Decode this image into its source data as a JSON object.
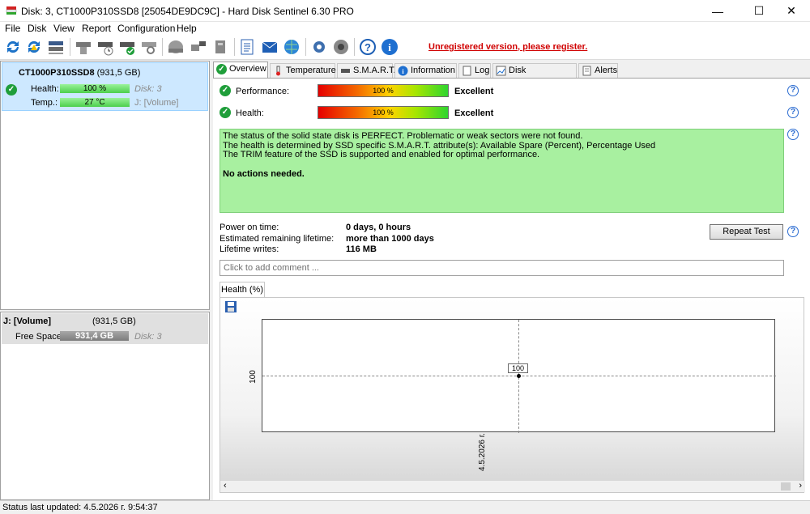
{
  "window": {
    "title": "Disk: 3, CT1000P310SSD8 [25054DE9DC9C]  -  Hard Disk Sentinel 6.30 PRO",
    "minimize": "—",
    "maximize": "☐",
    "close": "✕"
  },
  "menu": [
    "File",
    "Disk",
    "View",
    "Report",
    "Configuration",
    "Help"
  ],
  "toolbar": {
    "icons": [
      "refresh-icon",
      "refresh-warning-icon",
      "disk-list-icon",
      "disk-info-icon",
      "disk-schedule-icon",
      "disk-check-icon",
      "disk-search-icon",
      "disk-surface-icon",
      "disk-network-icon",
      "disk-backup-icon",
      "report-icon",
      "email-icon",
      "globe-icon",
      "settings-icon",
      "speaker-icon",
      "help-icon",
      "about-icon"
    ],
    "register_text": "Unregistered version, please register."
  },
  "disk": {
    "name": "CT1000P310SSD8",
    "size": "(931,5 GB)",
    "health_label": "Health:",
    "health_value": "100 %",
    "health_percent": 100,
    "temp_label": "Temp.:",
    "temp_value": "27 °C",
    "disk_no": "Disk: 3",
    "volume": "J: [Volume]"
  },
  "volume": {
    "name": "J: [Volume]",
    "size": "(931,5 GB)",
    "free_label": "Free Space",
    "free_value": "931,4 GB",
    "disk_no": "Disk: 3"
  },
  "tabs": [
    "Overview",
    "Temperature",
    "S.M.A.R.T.",
    "Information",
    "Log",
    "Disk Performance",
    "Alerts"
  ],
  "overview": {
    "performance_label": "Performance:",
    "performance_value": "100 %",
    "performance_rating": "Excellent",
    "health_label": "Health:",
    "health_value": "100 %",
    "health_rating": "Excellent",
    "status_lines": [
      "The status of the solid state disk is PERFECT. Problematic or weak sectors were not found.",
      "The health is determined by SSD specific S.M.A.R.T. attribute(s):  Available Spare (Percent), Percentage Used",
      "The TRIM feature of the SSD is supported and enabled for optimal performance."
    ],
    "status_action": "No actions needed.",
    "power_on_label": "Power on time:",
    "power_on_value": "0 days, 0 hours",
    "lifetime_label": "Estimated remaining lifetime:",
    "lifetime_value": "more than 1000 days",
    "writes_label": "Lifetime writes:",
    "writes_value": "116 MB",
    "repeat_button": "Repeat Test",
    "comment_placeholder": "Click to add comment ..."
  },
  "chart_data": {
    "type": "line",
    "tab_label": "Health (%)",
    "x": [
      "4.5.2026 г."
    ],
    "series": [
      {
        "values": [
          100
        ]
      }
    ],
    "ytick": "100",
    "data_label": "100"
  },
  "statusbar": "Status last updated: 4.5.2026 г. 9:54:37"
}
